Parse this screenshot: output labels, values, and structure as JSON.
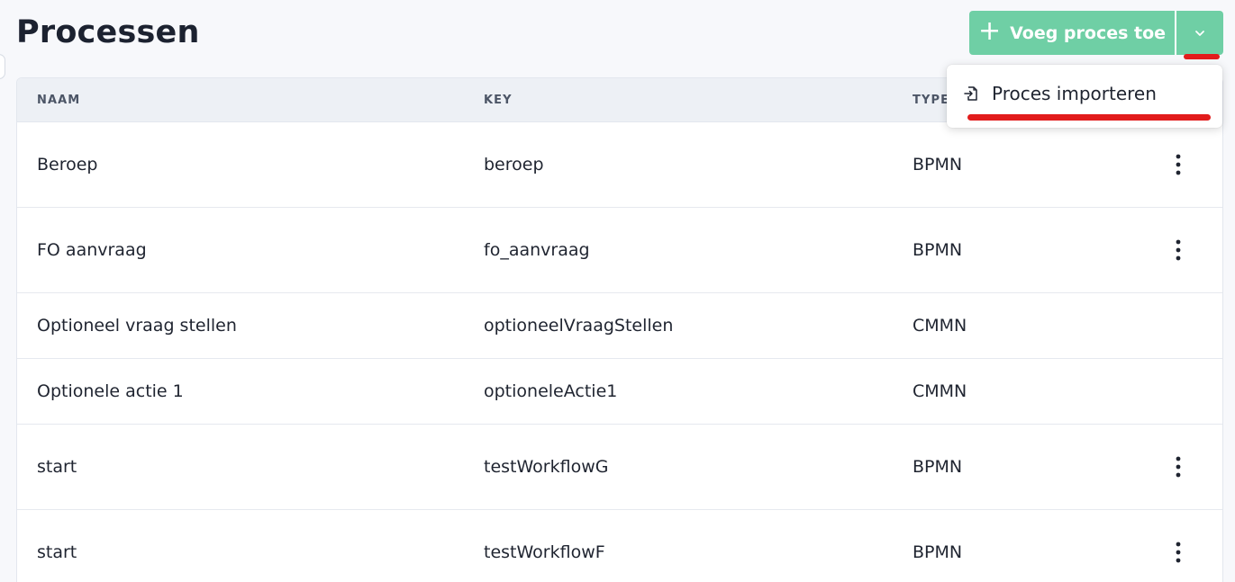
{
  "page": {
    "title": "Processen"
  },
  "toolbar": {
    "add_label": "Voeg proces toe",
    "add_icon": "plus-icon",
    "dropdown_icon": "chevron-down-icon"
  },
  "dropdown": {
    "items": [
      {
        "label": "Proces importeren",
        "icon": "import-file-icon"
      }
    ]
  },
  "table": {
    "columns": [
      "NAAM",
      "KEY",
      "TYPE"
    ],
    "rows": [
      {
        "name": "Beroep",
        "key": "beroep",
        "type": "BPMN",
        "has_menu": true
      },
      {
        "name": "FO aanvraag",
        "key": "fo_aanvraag",
        "type": "BPMN",
        "has_menu": true
      },
      {
        "name": "Optioneel vraag stellen",
        "key": "optioneelVraagStellen",
        "type": "CMMN",
        "has_menu": false
      },
      {
        "name": "Optionele actie 1",
        "key": "optioneleActie1",
        "type": "CMMN",
        "has_menu": false
      },
      {
        "name": "start",
        "key": "testWorkflowG",
        "type": "BPMN",
        "has_menu": true
      },
      {
        "name": "start",
        "key": "testWorkflowF",
        "type": "BPMN",
        "has_menu": true
      }
    ]
  },
  "colors": {
    "accent": "#6fcfa5",
    "annotation_red": "#e21c1c",
    "header_bg": "#edf0f5"
  }
}
